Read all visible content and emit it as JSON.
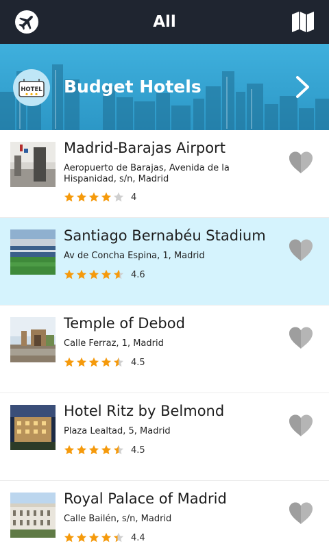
{
  "header": {
    "title": "All"
  },
  "banner": {
    "title": "Budget Hotels",
    "badge_text": "HOTEL"
  },
  "colors": {
    "header_bg": "#1f2530",
    "banner_bg": "#2c97c6",
    "star": "#f59a0c",
    "star_empty": "#cfcfcf",
    "highlight_row": "#d5f3fd",
    "heart": "#b5b5b5"
  },
  "places": [
    {
      "name": "Madrid-Barajas Airport",
      "address": "Aeropuerto de Barajas, Avenida de la Hispanidad, s/n, Madrid",
      "rating": 4,
      "rating_text": "4",
      "highlighted": false
    },
    {
      "name": "Santiago Bernabéu Stadium",
      "address": "Av de Concha Espina, 1, Madrid",
      "rating": 4.6,
      "rating_text": "4.6",
      "highlighted": true
    },
    {
      "name": "Temple of Debod",
      "address": "Calle Ferraz, 1, Madrid",
      "rating": 4.5,
      "rating_text": "4.5",
      "highlighted": false
    },
    {
      "name": "Hotel Ritz by Belmond",
      "address": "Plaza Lealtad, 5, Madrid",
      "rating": 4.5,
      "rating_text": "4.5",
      "highlighted": false
    },
    {
      "name": "Royal Palace of Madrid",
      "address": "Calle Bailén, s/n, Madrid",
      "rating": 4.4,
      "rating_text": "4.4",
      "highlighted": false
    }
  ]
}
